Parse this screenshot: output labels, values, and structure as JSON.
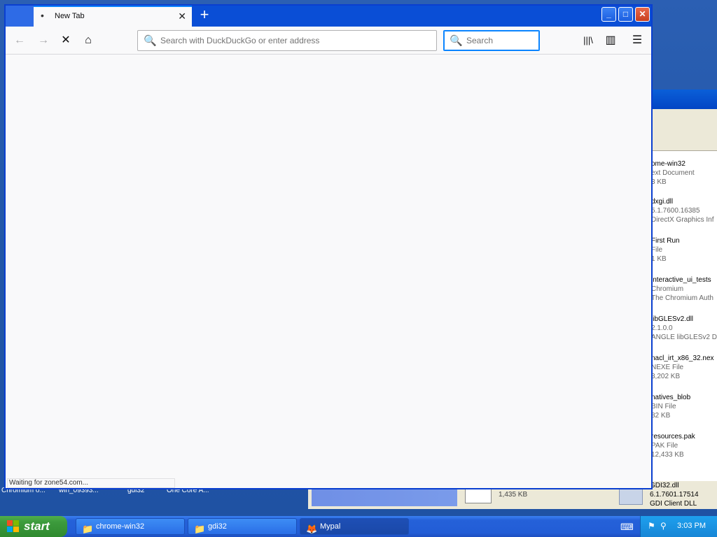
{
  "browser": {
    "tab_title": "New Tab",
    "tab_indicator": "•",
    "tab_close": "✕",
    "new_tab": "+",
    "url_placeholder": "Search with DuckDuckGo or enter address",
    "search_placeholder": "Search",
    "status_text": "Waiting for zone54.com..."
  },
  "window_controls": {
    "minimize": "_",
    "maximize": "□",
    "close": "✕"
  },
  "nav_icons": {
    "back": "←",
    "forward": "→",
    "stop": "✕",
    "home": "⌂",
    "library": "|||\\",
    "sidebar": "▥",
    "menu": "☰",
    "magnifier": "🔍"
  },
  "explorer": {
    "files": [
      {
        "name": "ome-win32",
        "type": "ext Document",
        "size": "3 KB"
      },
      {
        "name": "dxgi.dll",
        "type": "5.1.7600.16385",
        "size": "DirectX Graphics Inf"
      },
      {
        "name": "First Run",
        "type": "File",
        "size": "1 KB"
      },
      {
        "name": "interactive_ui_tests",
        "type": "Chromium",
        "size": "The Chromium Auth"
      },
      {
        "name": "libGLESv2.dll",
        "type": "2.1.0.0",
        "size": "ANGLE libGLESv2 Dy"
      },
      {
        "name": "nacl_irt_x86_32.nex",
        "type": "NEXE File",
        "size": "3,202 KB"
      },
      {
        "name": "natives_blob",
        "type": "BIN File",
        "size": "82 KB"
      },
      {
        "name": "resources.pak",
        "type": "PAK File",
        "size": "12,433 KB"
      }
    ],
    "bottom_size": "1,435 KB",
    "bottom_file": {
      "name": "GDI32.dll",
      "version": "6.1.7601.17514",
      "desc": "GDI Client DLL"
    }
  },
  "desktop_labels": [
    "Chromium o...",
    "win_09393...",
    "gdi32",
    "One Core A..."
  ],
  "taskbar": {
    "start_label": "start",
    "tasks": [
      {
        "label": "chrome-win32",
        "icon": "📁"
      },
      {
        "label": "gdi32",
        "icon": "📁"
      },
      {
        "label": "Mypal",
        "icon": "🦊"
      }
    ],
    "clock": "3:03 PM"
  }
}
